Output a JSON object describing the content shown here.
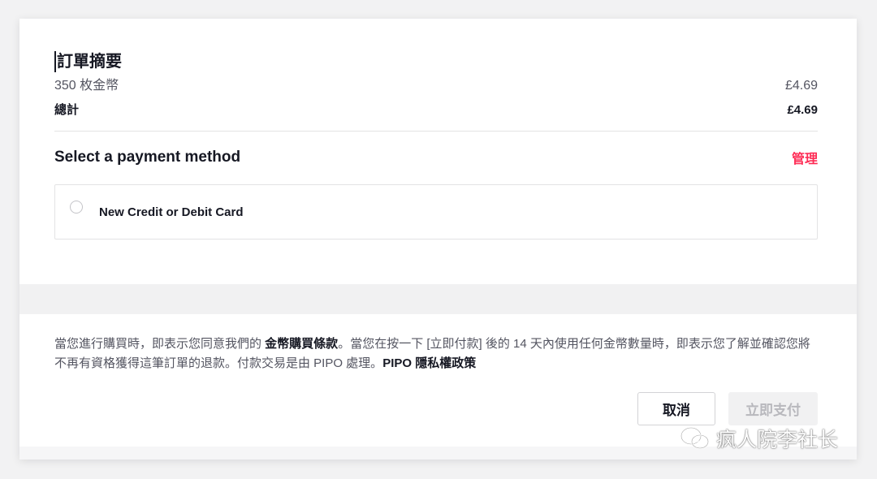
{
  "order_summary": {
    "title": "訂單摘要",
    "item_label": "350 枚金幣",
    "item_price": "£4.69",
    "total_label": "總計",
    "total_price": "£4.69"
  },
  "payment": {
    "heading": "Select a payment method",
    "manage_label": "管理",
    "option_label": "New Credit or Debit Card"
  },
  "notice": {
    "part1": "當您進行購買時，即表示您同意我們的 ",
    "terms_link": "金幣購買條款",
    "part2": "。當您在按一下 [立即付款] 後的 14 天內使用任何金幣數量時，即表示您了解並確認您將不再有資格獲得這筆訂單的退款。付款交易是由 PIPO 處理。",
    "privacy_link": "PIPO 隱私權政策"
  },
  "buttons": {
    "cancel_label": "取消",
    "pay_label": "立即支付"
  },
  "watermark": {
    "text": "疯人院李社长"
  },
  "colors": {
    "accent": "#fe2c55",
    "text_primary": "#161823",
    "text_secondary": "#545561"
  }
}
